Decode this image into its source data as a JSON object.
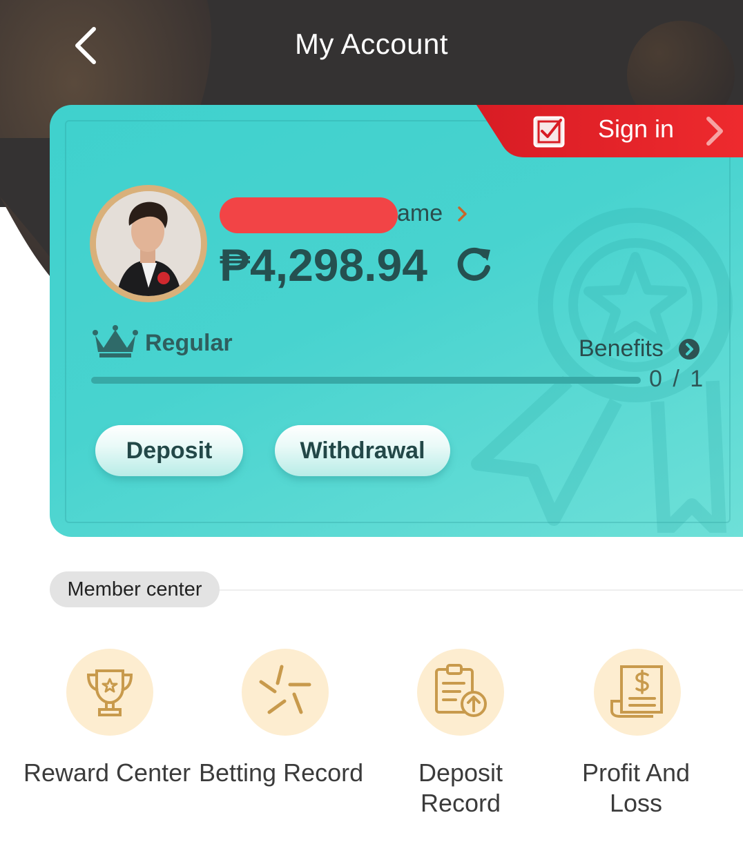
{
  "header": {
    "title": "My Account",
    "back_icon": "chevron-left-icon"
  },
  "sign_in": {
    "label": "Sign in",
    "icon": "checkbox-icon"
  },
  "profile": {
    "username_visible": "ame",
    "balance": "₱4,298.94",
    "level": "Regular",
    "benefits_label": "Benefits",
    "progress_text": "0 / 1",
    "progress_fraction": 0
  },
  "actions": {
    "deposit": "Deposit",
    "withdrawal": "Withdrawal"
  },
  "member_center": {
    "section_label": "Member center",
    "items": [
      {
        "label": "Reward Center",
        "icon": "trophy-icon"
      },
      {
        "label": "Betting Record",
        "icon": "betting-icon"
      },
      {
        "label": "Deposit\nRecord",
        "icon": "clipboard-upload-icon"
      },
      {
        "label": "Profit And\nLoss",
        "icon": "receipt-dollar-icon"
      }
    ]
  },
  "colors": {
    "header_dark": "#343232",
    "card_teal": "#48d3cf",
    "signin_red": "#e02128",
    "icon_gold": "#c89a4c",
    "icon_bg": "#fdedd0"
  }
}
